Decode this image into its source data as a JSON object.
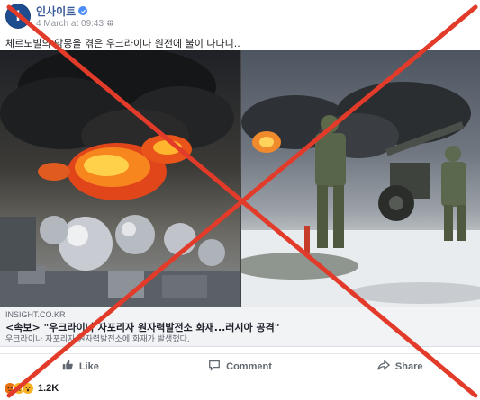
{
  "post": {
    "page_name": "인사이트",
    "avatar_letter": "I",
    "timestamp": "4 March at 09:43",
    "text": "체르노빌의 악몽을 겪은 우크라이나 원전에 불이 나다니..",
    "link": {
      "domain": "INSIGHT.CO.KR",
      "title": "<속보> \"우크라이나 자포리자 원자력발전소 화재...러시아 공격\"",
      "description": "우크라이나 자포리자 원자력발전소에 화재가 발생했다."
    }
  },
  "actions": {
    "like": "Like",
    "comment": "Comment",
    "share": "Share"
  },
  "reactions": {
    "count": "1.2K"
  },
  "colors": {
    "overlay_x": "#e23b2a",
    "page_blue": "#385898",
    "verified": "#4a8df6"
  },
  "icons": [
    "verified-badge-icon",
    "globe-icon",
    "like-icon",
    "comment-icon",
    "share-icon",
    "angry-reaction-icon",
    "sad-reaction-icon",
    "wow-reaction-icon"
  ]
}
